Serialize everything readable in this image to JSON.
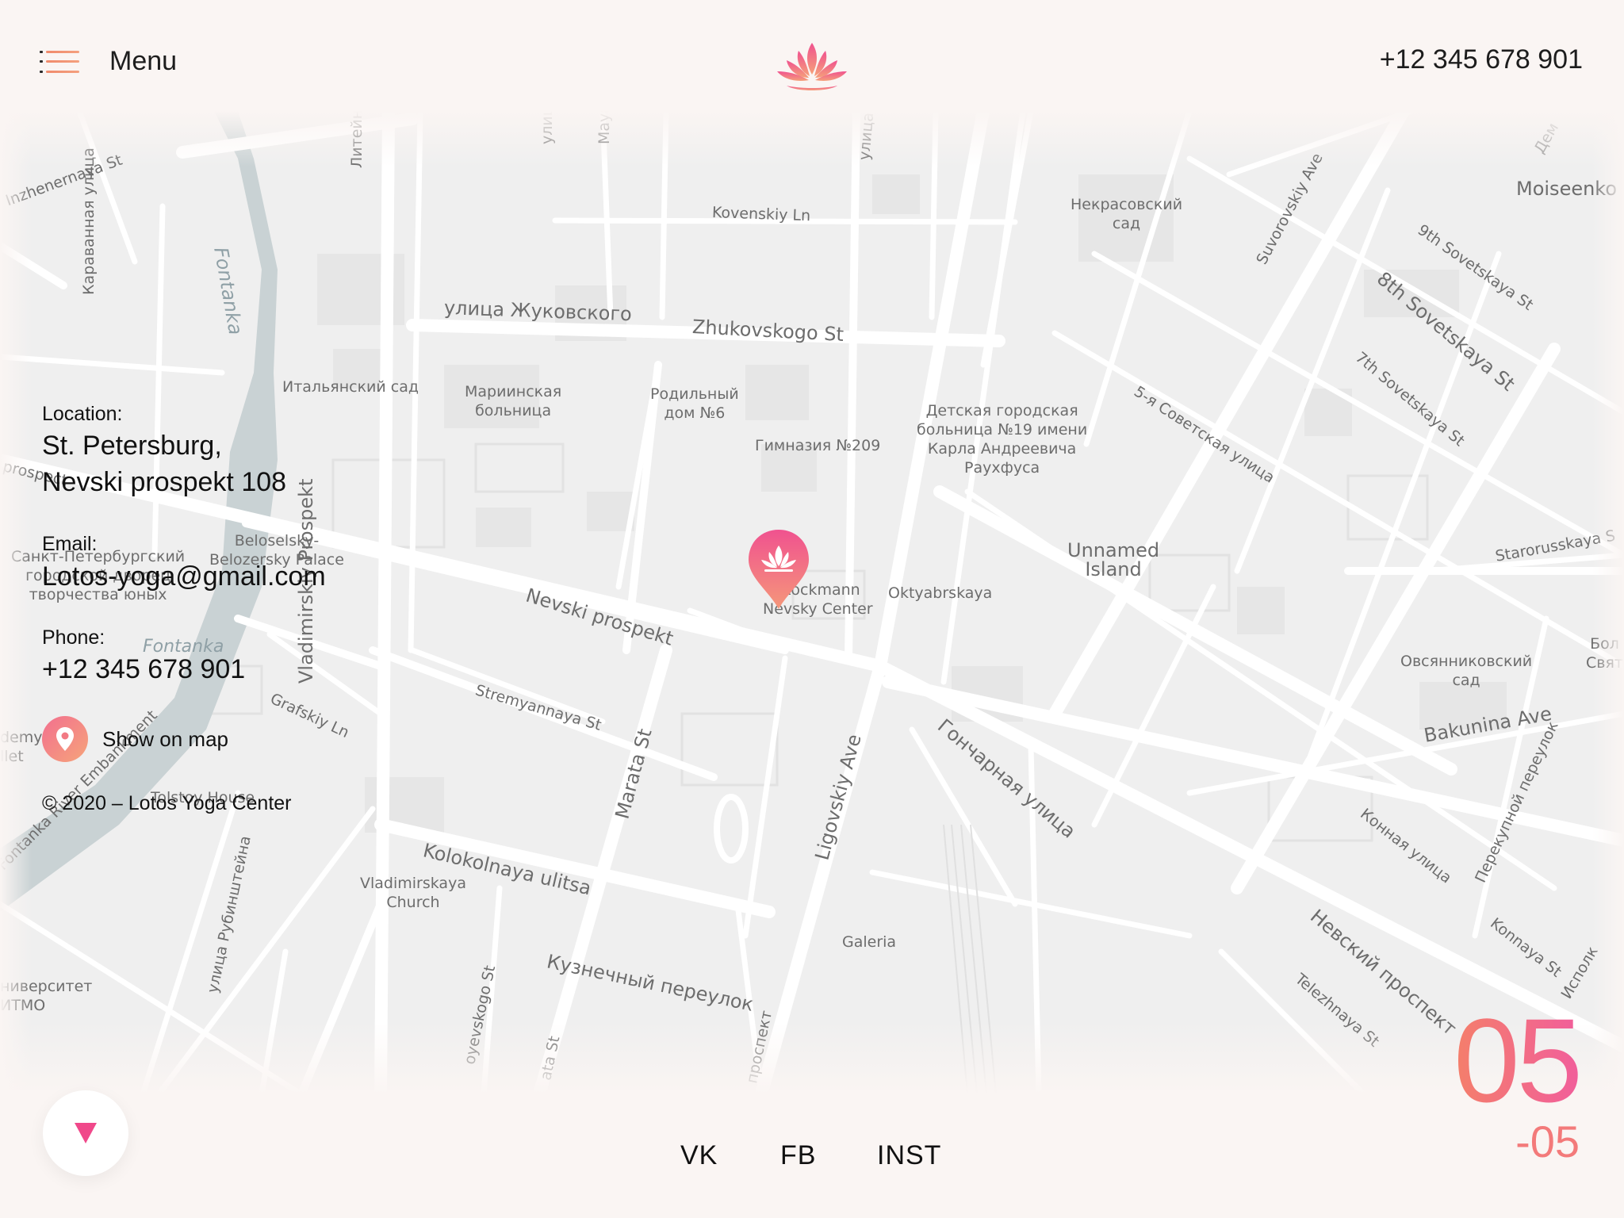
{
  "header": {
    "menu_label": "Menu",
    "phone": "+12 345 678 901",
    "logo_icon": "lotus-icon",
    "menu_icon": "hamburger-icon"
  },
  "contact": {
    "location_label": "Location:",
    "location_line1": "St. Petersburg,",
    "location_line2": "Nevski prospekt 108",
    "email_label": "Email:",
    "email": "Lotos-yoga@gmail.com",
    "phone_label": "Phone:",
    "phone": "+12 345 678 901",
    "show_map_label": "Show on map",
    "show_map_icon": "location-pin-icon",
    "copyright": "© 2020 – Lotos Yoga Center"
  },
  "map": {
    "labels": {
      "inzhenernaya": "Inzhenernaya St",
      "fontanka_top": "Fontanka",
      "karavannaya": "Караванная улица",
      "liteyny": "Литейный пр",
      "chekhova": "улица Чехова",
      "mayakovskogo": "Mayakovskogo St",
      "kovenskiy": "Kovenskiy Ln",
      "radishcheva": "улица Радищева",
      "nekrasovsky": "Некрасовский\nсад",
      "suvorovskiy": "Suvorovskiy Ave",
      "moiseenko": "Moiseenko S",
      "sov9": "9th Sovetskaya St",
      "sov8": "8th Sovetskaya St",
      "sov7": "7th Sovetskaya St",
      "zhukovskogo_ru": "улица Жуковского",
      "zhukovskogo": "Zhukovskogo St",
      "italyansky": "Итальянский сад",
      "mariinskaya": "Мариинская\nбольница",
      "rodilny": "Родильный\nдом №6",
      "gimnaziya": "Гимназия №209",
      "detskaya": "Детская городская\nбольница №19 имени\nКарла Андреевича\nРаухфуса",
      "sov5": "5-я Советская улица",
      "unnamed": "Unnamed\nIsland",
      "prospect_left": "prospect",
      "beloselsky": "Beloselsky-\nBelozersky Palace",
      "dvorets": "Санкт-Петербургский\nгородской дворец\nтворчества юных",
      "vladimirskiy": "Vladimirskiy Prospekt",
      "nevski": "Nevski prospekt",
      "stockmann": "Stockmann\nNevsky Center",
      "oktyabrskaya": "Oktyabrskaya",
      "starorusskaya": "Starorusskaya S",
      "ovsyannikovsky": "Овсянниковский\nсад",
      "bol": "Бол\nСвят",
      "bakunina": "Bakunina Ave",
      "stremyannaya": "Stremyannaya St",
      "marata": "Marata St",
      "ligovskiy": "Ligovskiy Ave",
      "goncharnaya": "Гончарная улица",
      "fontanka_mid": "Fontanka",
      "grafskiy": "Grafskiy Ln",
      "embankment": "Fontanka River Embankment",
      "academy": "demy\nllet",
      "tolstoy": "Tolstoy House",
      "konnaya_ru": "Конная улица",
      "pereulok": "Перекупной переулок",
      "konnaya": "Konnaya St",
      "ispolk": "Исполк",
      "kolokolnaya": "Kolokolnaya ulitsa",
      "vladimirskaya_church": "Vladimirskaya\nChurch",
      "rubinshteina": "улица Рубинштейна",
      "itmo": "ниверситет\nИТМО",
      "kuznechny": "Кузнечный переулок",
      "galeria": "Galeria",
      "nevsky_ru": "Невский проспект",
      "telezhnaya": "Telezhnaya St",
      "dostoevskogo": "oyevskogo St",
      "marata_bottom": "ata St",
      "prospekt_bottom": "проспект",
      "dem": "Дем"
    },
    "marker_icon": "lotus-marker-icon"
  },
  "footer": {
    "scroll_icon": "arrow-down-icon",
    "social": [
      "VK",
      "FB",
      "INST"
    ],
    "page_current": "05",
    "page_total": "-05"
  },
  "colors": {
    "accent_start": "#f47f6a",
    "accent_end": "#f15e9b",
    "background": "#faf5f3",
    "map_bg": "#efefef",
    "river": "#c9d2d4"
  }
}
